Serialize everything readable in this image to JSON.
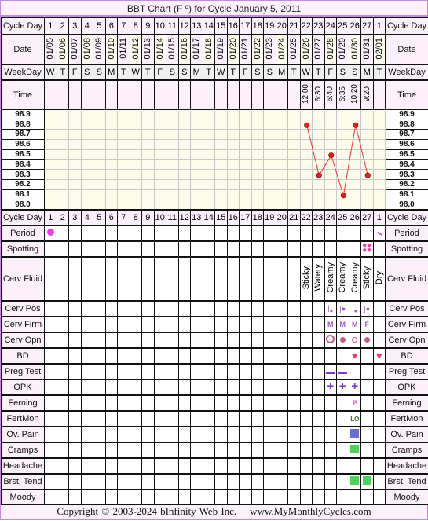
{
  "title": "BBT Chart (F º) for Cycle January 5, 2011",
  "labels": {
    "cycle_day": "Cycle Day",
    "date": "Date",
    "weekday": "WeekDay",
    "time": "Time",
    "period": "Period",
    "spotting": "Spotting",
    "cerv_fluid": "Cerv Fluid",
    "cerv_pos": "Cerv Pos",
    "cerv_firm": "Cerv Firm",
    "cerv_opn": "Cerv Opn",
    "bd": "BD",
    "preg_test": "Preg Test",
    "opk": "OPK",
    "ferning": "Ferning",
    "fertmon": "FertMon",
    "ov_pain": "Ov. Pain",
    "cramps": "Cramps",
    "headache": "Headache",
    "brst_tend": "Brst. Tend",
    "moody": "Moody"
  },
  "chart_data": {
    "type": "line",
    "title": "BBT Chart (F º) for Cycle January 5, 2011",
    "cycle_days": [
      "1",
      "2",
      "3",
      "4",
      "5",
      "6",
      "7",
      "8",
      "9",
      "10",
      "11",
      "12",
      "13",
      "14",
      "15",
      "16",
      "17",
      "18",
      "19",
      "20",
      "21",
      "22",
      "23",
      "24",
      "25",
      "26",
      "27",
      "1"
    ],
    "dates": [
      "01/05",
      "01/06",
      "01/07",
      "01/08",
      "01/09",
      "01/10",
      "01/11",
      "01/12",
      "01/13",
      "01/14",
      "01/15",
      "01/16",
      "01/17",
      "01/18",
      "01/19",
      "01/20",
      "01/21",
      "01/22",
      "01/23",
      "01/24",
      "01/25",
      "01/26",
      "01/27",
      "01/28",
      "01/29",
      "01/30",
      "01/31",
      "02/01"
    ],
    "weekdays": [
      "W",
      "T",
      "F",
      "S",
      "S",
      "M",
      "T",
      "W",
      "T",
      "F",
      "S",
      "S",
      "M",
      "T",
      "W",
      "T",
      "F",
      "S",
      "S",
      "M",
      "T",
      "W",
      "T",
      "F",
      "S",
      "S",
      "M",
      "T"
    ],
    "times": [
      "",
      "",
      "",
      "",
      "",
      "",
      "",
      "",
      "",
      "",
      "",
      "",
      "",
      "",
      "",
      "",
      "",
      "",
      "",
      "",
      "",
      "12:00",
      "6:30",
      "6:40",
      "6:35",
      "10:20",
      "9:20",
      "",
      ""
    ],
    "temperatures": [
      null,
      null,
      null,
      null,
      null,
      null,
      null,
      null,
      null,
      null,
      null,
      null,
      null,
      null,
      null,
      null,
      null,
      null,
      null,
      null,
      null,
      98.8,
      98.3,
      98.5,
      98.1,
      98.8,
      98.3,
      null
    ],
    "y_ticks": [
      "98.9",
      "98.8",
      "98.7",
      "98.6",
      "98.5",
      "98.4",
      "98.3",
      "98.2",
      "98.1",
      "98.0"
    ],
    "ylim": [
      98.0,
      98.9
    ],
    "line_color": "#ff3030",
    "marker_color": "#e02020"
  },
  "observations": {
    "period": {
      "1": "heavy-dot",
      "28": "light-dots"
    },
    "spotting": {
      "27": "spotting-dots"
    },
    "cerv_fluid": {
      "22": "Sticky",
      "23": "Watery",
      "24": "Creamy",
      "25": "Creamy",
      "26": "Creamy",
      "27": "Sticky",
      "28": "Dry"
    },
    "cerv_pos": {
      "24": "low",
      "25": "mid",
      "26": "low",
      "27": "mid"
    },
    "cerv_firm": {
      "24": "M",
      "25": "M",
      "26": "M",
      "27": "F"
    },
    "cerv_opn": {
      "24": "open",
      "25": "closed",
      "26": "medium",
      "27": "closed"
    },
    "bd": {
      "26": "heart",
      "28": "heart"
    },
    "preg_test": {
      "24": "negative",
      "25": "negative"
    },
    "opk": {
      "24": "positive",
      "25": "positive",
      "26": "positive"
    },
    "ferning": {
      "26": "P"
    },
    "fertmon": {
      "26": "LO"
    },
    "ov_pain": {
      "26": "square"
    },
    "cramps": {
      "26": "square"
    },
    "headache": {},
    "brst_tend": {
      "26": "square",
      "27": "square"
    },
    "moody": {}
  },
  "colors": {
    "border": "#c58be0",
    "period": "#e83ee8",
    "spotting": "#e8409a",
    "cerv": "#9a5cc8",
    "opn": "#c06080",
    "heart": "#e83c7a",
    "test": "#7a3cc8",
    "ferning": "#d060c0",
    "fertmon": "#2a7a2a",
    "ov_pain": "#6a70d0",
    "green": "#50d060"
  },
  "footer": "Copyright © 2003-2024 bInfinity Web Inc.    www.MyMonthlyCycles.com"
}
